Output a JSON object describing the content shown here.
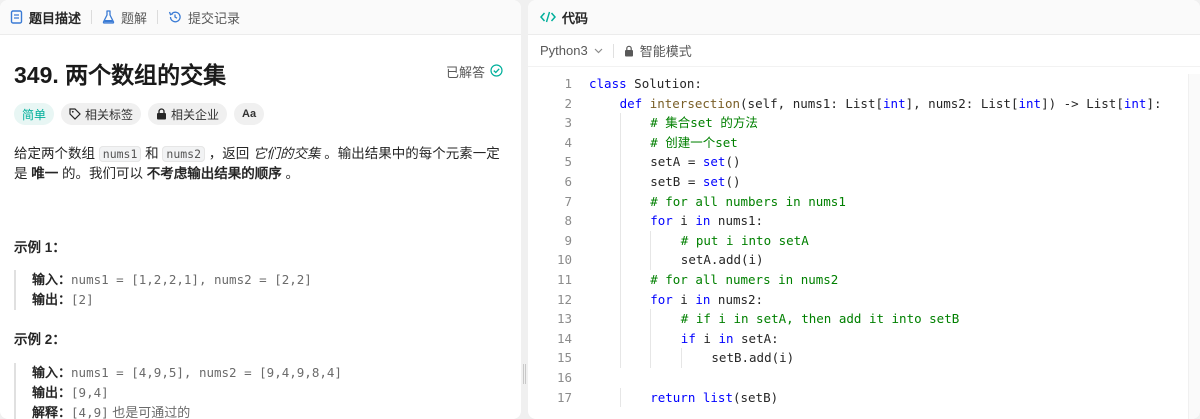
{
  "left_tabs": [
    {
      "label": "题目描述",
      "icon": "description-icon",
      "active": true
    },
    {
      "label": "题解",
      "icon": "flask-icon",
      "active": false
    },
    {
      "label": "提交记录",
      "icon": "history-icon",
      "active": false
    }
  ],
  "problem": {
    "title": "349. 两个数组的交集",
    "status": "已解答",
    "tags": [
      {
        "label": "简单",
        "type": "difficulty"
      },
      {
        "label": "相关标签",
        "icon": "tag-icon"
      },
      {
        "label": "相关企业",
        "icon": "lock-icon"
      },
      {
        "label": "Aa",
        "icon": "translate-icon"
      }
    ],
    "desc_1": "给定两个数组 ",
    "desc_code1": "nums1",
    "desc_2": " 和 ",
    "desc_code2": "nums2",
    "desc_3": " ，返回 ",
    "desc_em": "它们的交集",
    "desc_4": " 。输出结果中的每个元素一定是 ",
    "desc_bold1": "唯一",
    "desc_5": " 的。我们可以 ",
    "desc_bold2": "不考虑输出结果的顺序",
    "desc_6": " 。",
    "example1": {
      "title": "示例 1：",
      "input_label": "输入：",
      "input": "nums1 = [1,2,2,1], nums2 = [2,2]",
      "output_label": "输出：",
      "output": "[2]"
    },
    "example2": {
      "title": "示例 2：",
      "input_label": "输入：",
      "input": "nums1 = [4,9,5], nums2 = [9,4,9,8,4]",
      "output_label": "输出：",
      "output": "[9,4]",
      "explain_label": "解释：",
      "explain_code": "[4,9]",
      "explain": " 也是可通过的"
    }
  },
  "code_panel": {
    "title": "代码",
    "language": "Python3",
    "mode": "智能模式"
  },
  "code_lines": [
    {
      "n": "1",
      "indent": 0,
      "tokens": [
        [
          "kw",
          "class"
        ],
        [
          "",
          " Solution:"
        ]
      ]
    },
    {
      "n": "2",
      "indent": 1,
      "tokens": [
        [
          "kw",
          "def"
        ],
        [
          "",
          " "
        ],
        [
          "fn",
          "intersection"
        ],
        [
          "",
          "(self, nums1: List["
        ],
        [
          "kw",
          "int"
        ],
        [
          "",
          "], nums2: List["
        ],
        [
          "kw",
          "int"
        ],
        [
          "",
          "]) -> List["
        ],
        [
          "kw",
          "int"
        ],
        [
          "",
          "]:"
        ]
      ]
    },
    {
      "n": "3",
      "indent": 2,
      "tokens": [
        [
          "cm",
          "# 集合set 的方法"
        ]
      ]
    },
    {
      "n": "4",
      "indent": 2,
      "tokens": [
        [
          "cm",
          "# 创建一个set"
        ]
      ]
    },
    {
      "n": "5",
      "indent": 2,
      "tokens": [
        [
          "",
          "setA = "
        ],
        [
          "kw",
          "set"
        ],
        [
          "",
          "()"
        ]
      ]
    },
    {
      "n": "6",
      "indent": 2,
      "tokens": [
        [
          "",
          "setB = "
        ],
        [
          "kw",
          "set"
        ],
        [
          "",
          "()"
        ]
      ]
    },
    {
      "n": "7",
      "indent": 2,
      "tokens": [
        [
          "cm",
          "# for all numbers in nums1"
        ]
      ]
    },
    {
      "n": "8",
      "indent": 2,
      "tokens": [
        [
          "kw",
          "for"
        ],
        [
          "",
          " i "
        ],
        [
          "kw",
          "in"
        ],
        [
          "",
          " nums1:"
        ]
      ]
    },
    {
      "n": "9",
      "indent": 3,
      "tokens": [
        [
          "cm",
          "# put i into setA"
        ]
      ]
    },
    {
      "n": "10",
      "indent": 3,
      "tokens": [
        [
          "",
          "setA.add(i)"
        ]
      ]
    },
    {
      "n": "11",
      "indent": 2,
      "tokens": [
        [
          "cm",
          "# for all numers in nums2"
        ]
      ]
    },
    {
      "n": "12",
      "indent": 2,
      "tokens": [
        [
          "kw",
          "for"
        ],
        [
          "",
          " i "
        ],
        [
          "kw",
          "in"
        ],
        [
          "",
          " nums2:"
        ]
      ]
    },
    {
      "n": "13",
      "indent": 3,
      "tokens": [
        [
          "cm",
          "# if i in setA, then add it into setB"
        ]
      ]
    },
    {
      "n": "14",
      "indent": 3,
      "tokens": [
        [
          "kw",
          "if"
        ],
        [
          "",
          " i "
        ],
        [
          "kw",
          "in"
        ],
        [
          "",
          " setA:"
        ]
      ]
    },
    {
      "n": "15",
      "indent": 4,
      "tokens": [
        [
          "",
          "setB.add(i)"
        ]
      ]
    },
    {
      "n": "16",
      "indent": 0,
      "tokens": []
    },
    {
      "n": "17",
      "indent": 2,
      "tokens": [
        [
          "kw",
          "return"
        ],
        [
          "",
          " "
        ],
        [
          "kw",
          "list"
        ],
        [
          "",
          "(setB)"
        ]
      ]
    }
  ],
  "colors": {
    "accent_green": "#00af9b",
    "keyword": "#0000ff",
    "comment": "#008000",
    "function": "#795e26"
  }
}
